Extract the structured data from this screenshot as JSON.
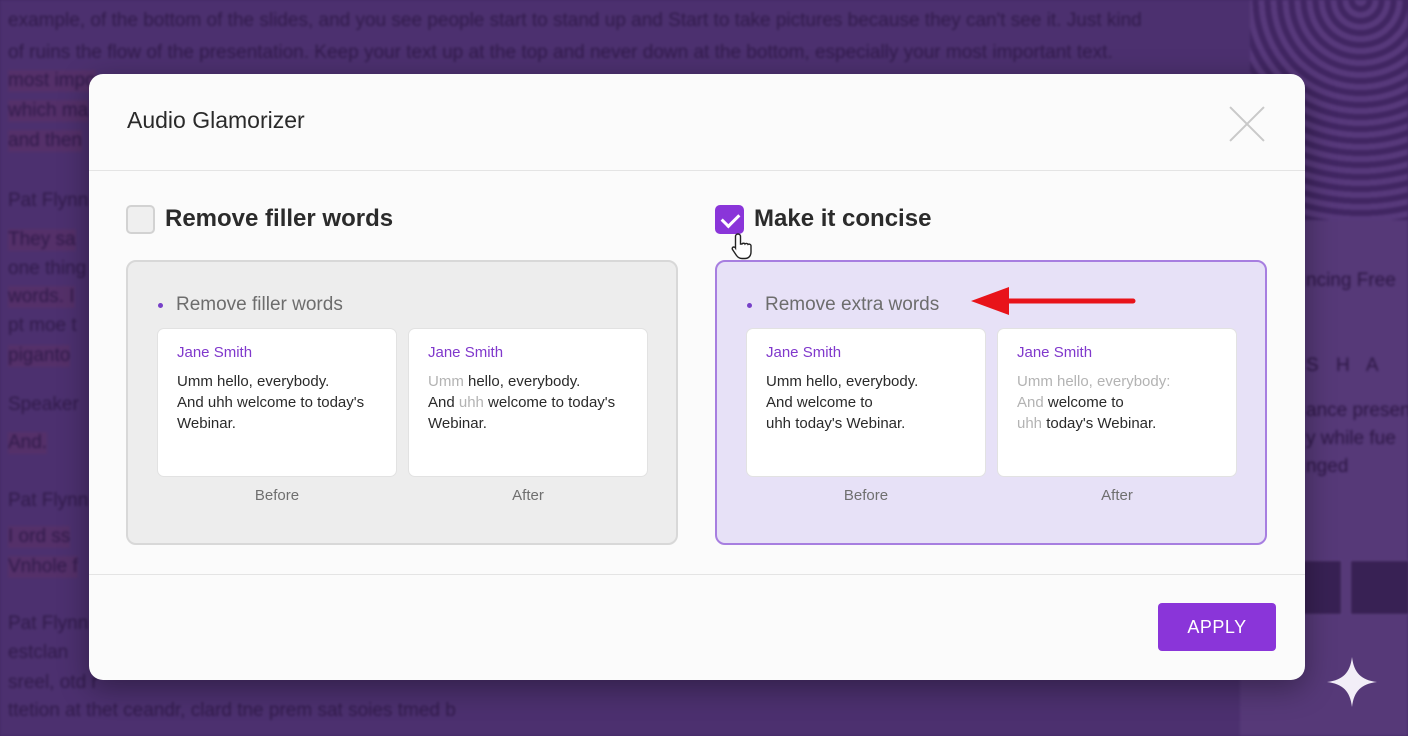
{
  "background": {
    "lines": [
      "example, of the bottom of the slides, and you see people start to stand up and Start to take pictures because they can't see it. Just kind",
      "of ruins the flow of the presentation. Keep your text up at the top and never down at the bottom, especially your most important text.",
      "most impo",
      "which ma",
      "and then",
      "Pat Flynn",
      "They sa",
      "one thing",
      "words. I",
      "pt moe t",
      "piganto",
      "Speaker",
      "And.",
      "Pat Flynn",
      "I ord ss",
      "Vnhole f",
      "Pat Flynn",
      "estclan",
      "sreel, otd r",
      "ttetion at thet ceandr, clard tne prem sat soies tmed b"
    ],
    "side_texts": [
      "ncing Free",
      "S H A",
      "ance presen",
      "y while fue",
      "nged"
    ]
  },
  "dialog": {
    "title": "Audio Glamorizer",
    "apply_label": "APPLY",
    "options": [
      {
        "label": "Remove filler words",
        "checked": false,
        "bullet": "Remove filler words",
        "before": {
          "name": "Jane Smith",
          "line1": "Umm hello, everybody.",
          "line2": "And uhh welcome to today's",
          "line3": "Webinar."
        },
        "after": {
          "name": "Jane Smith",
          "line1_faded": "Umm",
          "line1_rest": " hello, everybody.",
          "line2_a": "And ",
          "line2_faded": "uhh",
          "line2_b": " welcome to today's",
          "line3": "Webinar."
        },
        "before_caption": "Before",
        "after_caption": "After"
      },
      {
        "label": "Make it concise",
        "checked": true,
        "bullet": "Remove extra words",
        "before": {
          "name": "Jane Smith",
          "line1": "Umm hello, everybody.",
          "line2": "And welcome to",
          "line3": "uhh today's Webinar."
        },
        "after": {
          "name": "Jane Smith",
          "line1_faded": "Umm hello, everybody:",
          "line2_faded": "And",
          "line2_rest": " welcome to",
          "line3_faded": "uhh",
          "line3_rest": " today's Webinar."
        },
        "before_caption": "Before",
        "after_caption": "After"
      }
    ]
  },
  "colors": {
    "accent": "#8a35d9",
    "annotation_arrow": "#e8131a",
    "selected_card_bg": "#e7e1f7"
  },
  "icons": [
    "close-icon",
    "checkbox-icon",
    "hand-pointer-icon",
    "red-arrow-icon",
    "sparkle-icon"
  ]
}
